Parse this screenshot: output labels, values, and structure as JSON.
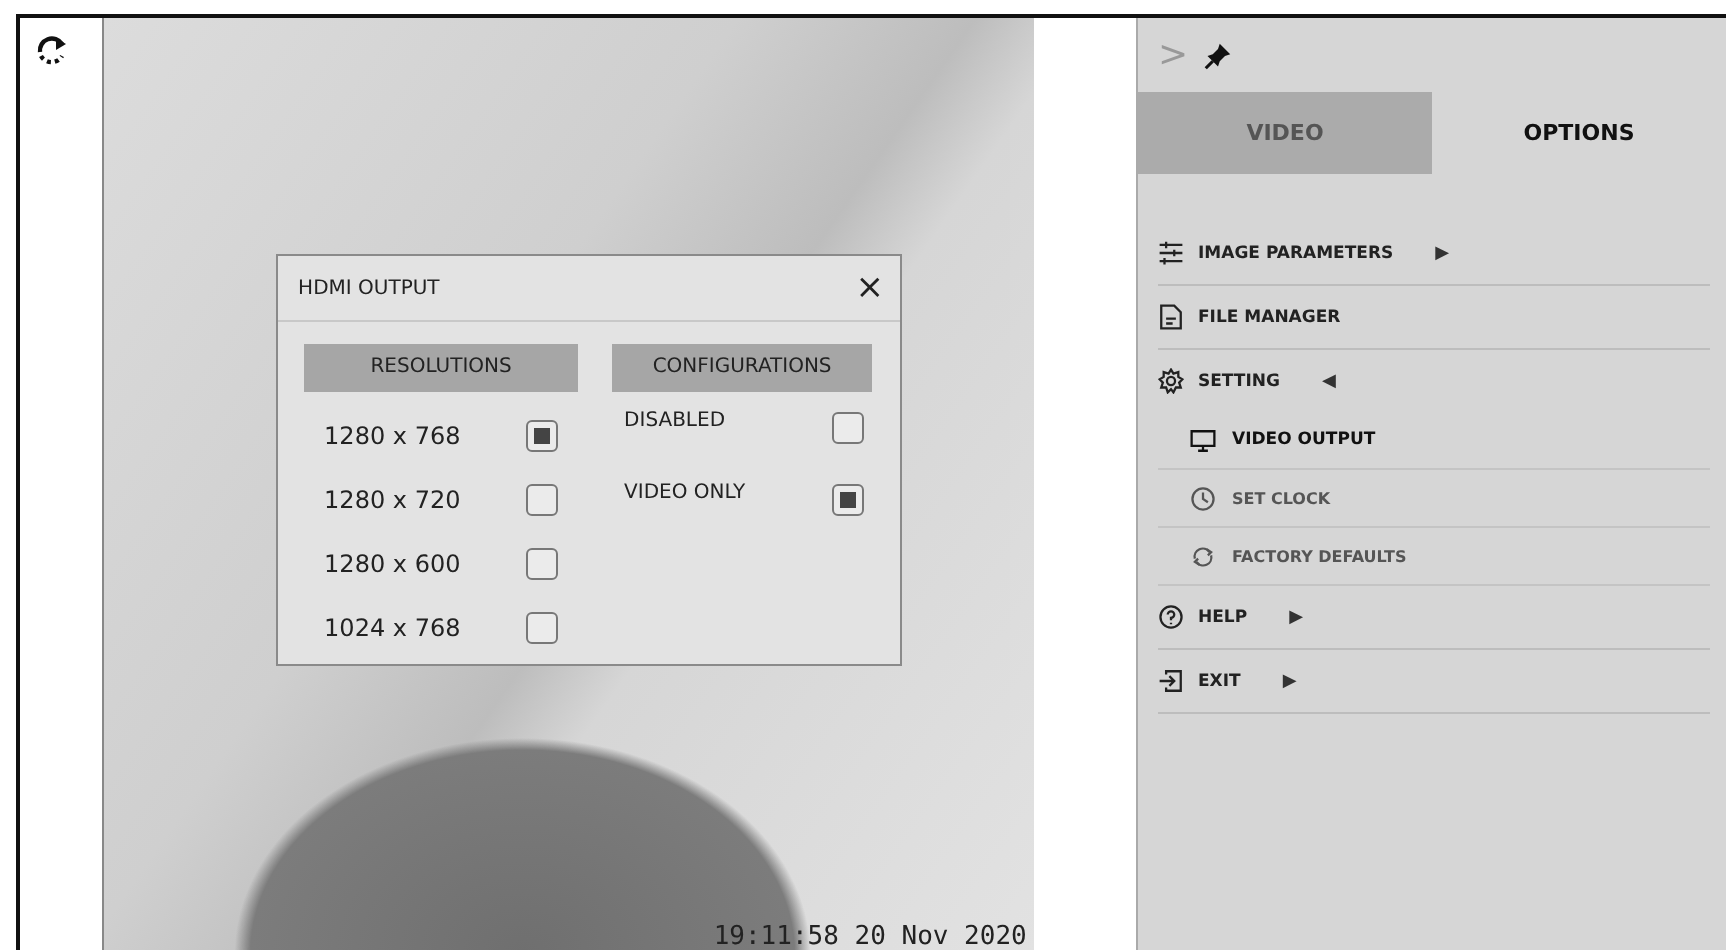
{
  "video": {
    "timestamp": "19:11:58 20 Nov 2020"
  },
  "dialog": {
    "title": "HDMI OUTPUT",
    "close": "×",
    "resolutions": {
      "heading": "RESOLUTIONS",
      "options": [
        {
          "label": "1280 x 768",
          "checked": true
        },
        {
          "label": "1280 x 720",
          "checked": false
        },
        {
          "label": "1280 x 600",
          "checked": false
        },
        {
          "label": "1024 x 768",
          "checked": false
        }
      ]
    },
    "configurations": {
      "heading": "CONFIGURATIONS",
      "options": [
        {
          "label": "DISABLED",
          "checked": false
        },
        {
          "label": "VIDEO ONLY",
          "checked": true
        }
      ]
    }
  },
  "panel": {
    "collapse": ">",
    "tabs": [
      {
        "label": "VIDEO",
        "selected": false
      },
      {
        "label": "OPTIONS",
        "selected": true
      }
    ],
    "menu": [
      {
        "label": "IMAGE PARAMETERS",
        "arrow": "▶",
        "expanded": false
      },
      {
        "label": "FILE MANAGER",
        "expanded": false
      },
      {
        "label": "SETTING",
        "arrow": "◀",
        "expanded": true,
        "children": [
          {
            "label": "VIDEO OUTPUT",
            "selected": true
          },
          {
            "label": "SET CLOCK",
            "selected": false
          },
          {
            "label": "FACTORY DEFAULTS",
            "selected": false
          }
        ]
      },
      {
        "label": "HELP",
        "arrow": "▶",
        "expanded": false
      },
      {
        "label": "EXIT",
        "arrow": "▶",
        "expanded": false
      }
    ]
  }
}
